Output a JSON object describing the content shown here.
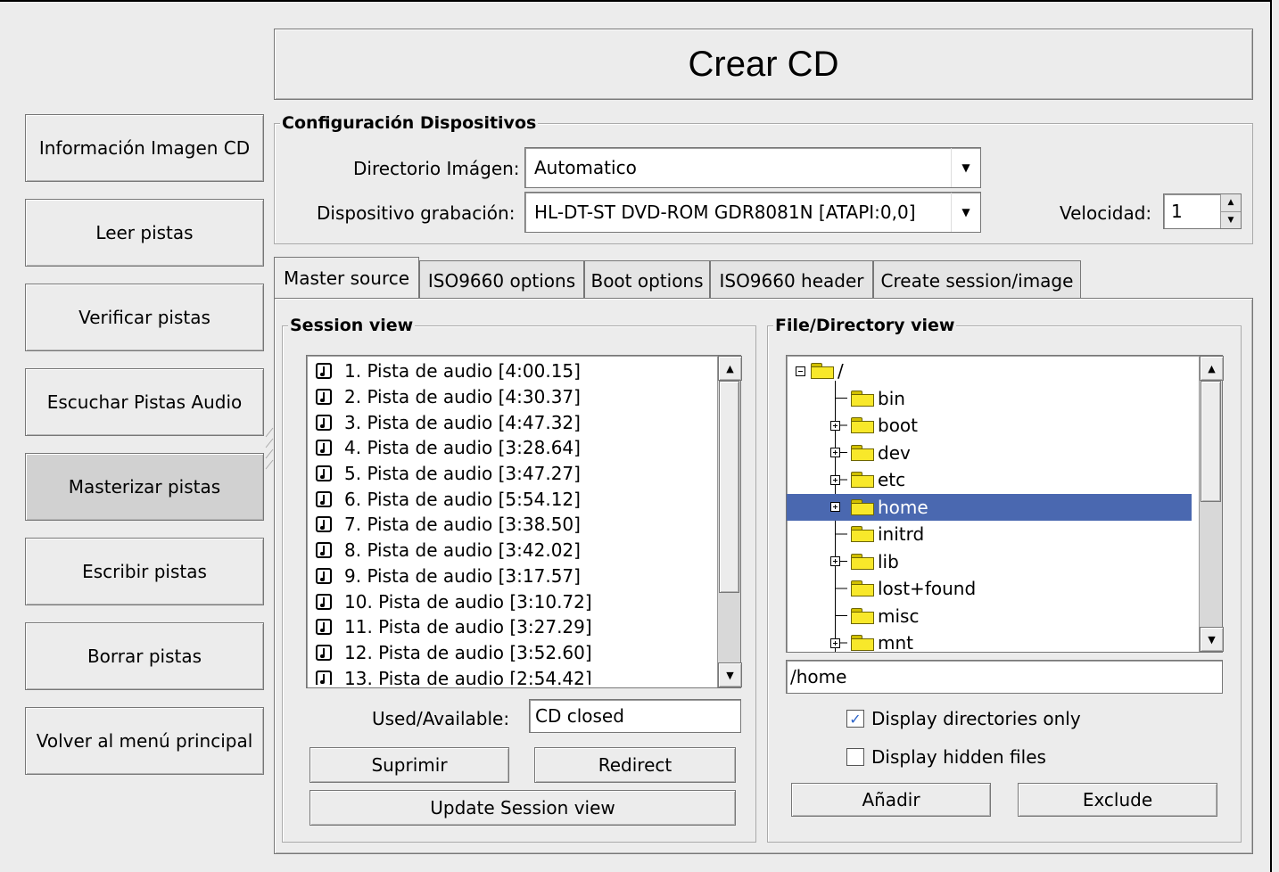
{
  "window": {
    "title": "Crear CD"
  },
  "sidebar": {
    "items": [
      {
        "label": "Información Imagen CD",
        "active": false
      },
      {
        "label": "Leer pistas",
        "active": false
      },
      {
        "label": "Verificar pistas",
        "active": false
      },
      {
        "label": "Escuchar Pistas Audio",
        "active": false
      },
      {
        "label": "Masterizar pistas",
        "active": true
      },
      {
        "label": "Escribir pistas",
        "active": false
      },
      {
        "label": "Borrar pistas",
        "active": false
      },
      {
        "label": "Volver al menú principal",
        "active": false
      }
    ]
  },
  "devices": {
    "legend": "Configuración Dispositivos",
    "image_dir_label": "Directorio Imágen:",
    "image_dir_value": "Automatico",
    "recorder_label": "Dispositivo grabación:",
    "recorder_value": "HL-DT-ST DVD-ROM GDR8081N [ATAPI:0,0]",
    "speed_label": "Velocidad:",
    "speed_value": "1"
  },
  "tabs": [
    {
      "label": "Master source",
      "active": true
    },
    {
      "label": "ISO9660 options",
      "active": false
    },
    {
      "label": "Boot options",
      "active": false
    },
    {
      "label": "ISO9660 header",
      "active": false
    },
    {
      "label": "Create session/image",
      "active": false
    }
  ],
  "session": {
    "legend": "Session view",
    "tracks": [
      "1. Pista de audio [4:00.15]",
      "2. Pista de audio [4:30.37]",
      "3. Pista de audio [4:47.32]",
      "4. Pista de audio [3:28.64]",
      "5. Pista de audio [3:47.27]",
      "6. Pista de audio [5:54.12]",
      "7. Pista de audio [3:38.50]",
      "8. Pista de audio [3:42.02]",
      "9. Pista de audio [3:17.57]",
      "10. Pista de audio [3:10.72]",
      "11. Pista de audio [3:27.29]",
      "12. Pista de audio [3:52.60]",
      "13. Pista de audio [2:54.42]"
    ],
    "used_label": "Used/Available:",
    "used_value": "CD closed",
    "remove_label": "Suprimir",
    "redirect_label": "Redirect",
    "update_label": "Update Session view"
  },
  "files": {
    "legend": "File/Directory view",
    "root": "/",
    "entries": [
      {
        "name": "bin",
        "expandable": false,
        "selected": false
      },
      {
        "name": "boot",
        "expandable": true,
        "selected": false
      },
      {
        "name": "dev",
        "expandable": true,
        "selected": false
      },
      {
        "name": "etc",
        "expandable": true,
        "selected": false
      },
      {
        "name": "home",
        "expandable": true,
        "selected": true
      },
      {
        "name": "initrd",
        "expandable": false,
        "selected": false
      },
      {
        "name": "lib",
        "expandable": true,
        "selected": false
      },
      {
        "name": "lost+found",
        "expandable": false,
        "selected": false
      },
      {
        "name": "misc",
        "expandable": false,
        "selected": false
      },
      {
        "name": "mnt",
        "expandable": true,
        "selected": false
      }
    ],
    "path_value": "/home",
    "dirs_only_label": "Display directories only",
    "dirs_only_checked": true,
    "hidden_label": "Display hidden files",
    "hidden_checked": false,
    "add_label": "Añadir",
    "exclude_label": "Exclude"
  },
  "colors": {
    "selection": "#4a68b0",
    "check": "#2a62c8"
  }
}
